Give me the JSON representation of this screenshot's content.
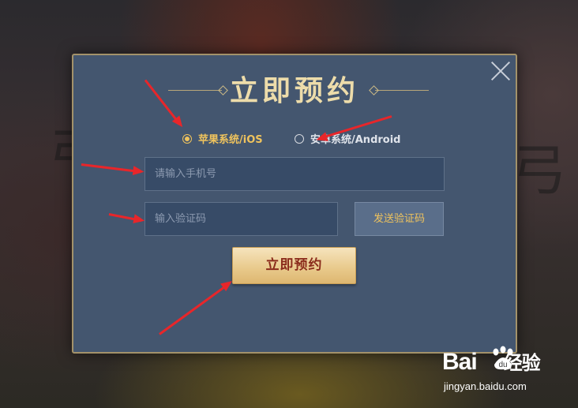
{
  "modal": {
    "title": "立即预约",
    "platforms": [
      {
        "label": "苹果系统/iOS",
        "selected": true
      },
      {
        "label": "安卓系统/Android",
        "selected": false
      }
    ],
    "phone_placeholder": "请输入手机号",
    "code_placeholder": "输入验证码",
    "send_code_label": "发送验证码",
    "submit_label": "立即预约"
  },
  "watermark": {
    "logo_text": "Bai",
    "logo_suffix": "经验",
    "url": "jingyan.baidu.com"
  },
  "colors": {
    "modal_bg": "#44566f",
    "accent_gold": "#efc35d",
    "annotation_red": "#e8262a"
  }
}
